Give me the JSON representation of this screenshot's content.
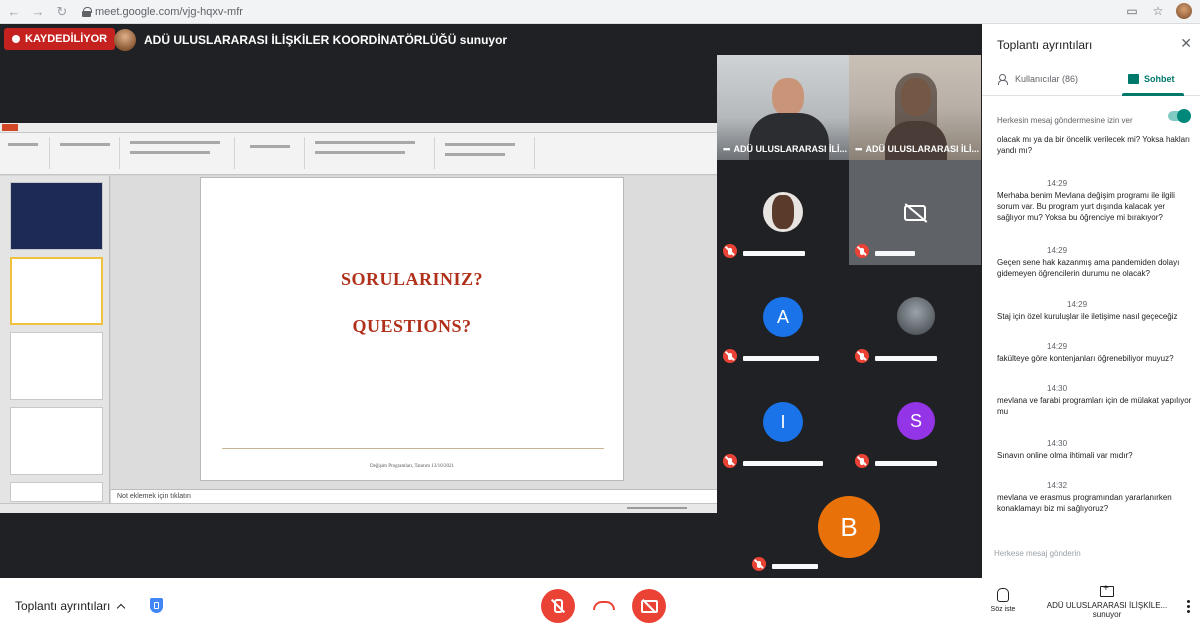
{
  "browser": {
    "url": "meet.google.com/vjg-hqxv-mfr",
    "back_icon": "arrow-left-icon",
    "forward_icon": "arrow-right-icon",
    "reload_icon": "reload-icon"
  },
  "recording": {
    "label": "KAYDEDİLİYOR",
    "color": "#c5221f"
  },
  "presenter": {
    "banner": "ADÜ ULUSLARARASI İLİŞKİLER KOORDİNATÖRLÜĞÜ sunuyor"
  },
  "presentation": {
    "line1": "SORULARINIZ?",
    "line2": "QUESTIONS?",
    "footer": "Değişim Programları, Tanıtım 13/10/2021",
    "notes": "Not eklemek için tıklatın",
    "text_color": "#b0301a"
  },
  "participants": [
    {
      "name": "ADÜ ULUSLARARASI İLİ...",
      "speaking": true
    },
    {
      "name": "ADÜ ULUSLARARASI İLİ...",
      "speaking": true
    },
    {
      "initial": "",
      "muted": true
    },
    {
      "initial": "",
      "muted": true,
      "camera_off": true
    },
    {
      "initial": "A",
      "muted": true,
      "color": "#1a73e8"
    },
    {
      "initial": "",
      "muted": true
    },
    {
      "initial": "I",
      "muted": true,
      "color": "#1a73e8"
    },
    {
      "initial": "S",
      "muted": true,
      "color": "#9334e6"
    },
    {
      "initial": "B",
      "muted": true,
      "color": "#e8710a"
    }
  ],
  "sidebar": {
    "title": "Toplantı ayrıntıları",
    "tabs": [
      {
        "label": "Kullanıcılar (86)",
        "icon": "people-icon"
      },
      {
        "label": "Sohbet",
        "icon": "chat-icon",
        "active": true
      }
    ],
    "toggle_label": "Herkesin mesaj göndermesine izin ver",
    "messages": [
      {
        "time": "",
        "text": "olacak mı ya da bir öncelik verilecek mi? Yoksa hakları yandı mı?"
      },
      {
        "time": "14:29",
        "text": "Merhaba benim Mevlana değişim programı ile ilgili sorum var. Bu program yurt dışında kalacak yer sağlıyor mu? Yoksa bu öğrenciye mi bırakıyor?"
      },
      {
        "time": "14:29",
        "text": "Geçen sene hak kazanmış ama pandemiden dolayı gidemeyen öğrencilerin durumu ne olacak?"
      },
      {
        "time": "14:29",
        "text": "Staj için özel kuruluşlar ile iletişime nasıl geçeceğiz"
      },
      {
        "time": "14:29",
        "text": "fakülteye göre kontenjanları öğrenebiliyor muyuz?"
      },
      {
        "time": "14:30",
        "text": "mevlana ve farabi programları için de mülakat yapılıyor mu"
      },
      {
        "time": "14:30",
        "text": "Sınavın online olma ihtimali var mıdır?"
      },
      {
        "time": "14:32",
        "text": "mevlana ve erasmus programından yararlanırken konaklamayı biz mi sağlıyoruz?"
      }
    ],
    "input_placeholder": "Herkese mesaj gönderin"
  },
  "bottom": {
    "meeting_details": "Toplantı ayrıntıları",
    "raise_hand": "Söz iste",
    "presenting_name": "ADÜ ULUSLARARASI İLİŞKİLE...",
    "presenting_sub": "sunuyor",
    "mic_icon": "mic-off-icon",
    "cam_icon": "camera-off-icon",
    "hangup_icon": "hangup-icon",
    "accent_red": "#ea4335"
  }
}
